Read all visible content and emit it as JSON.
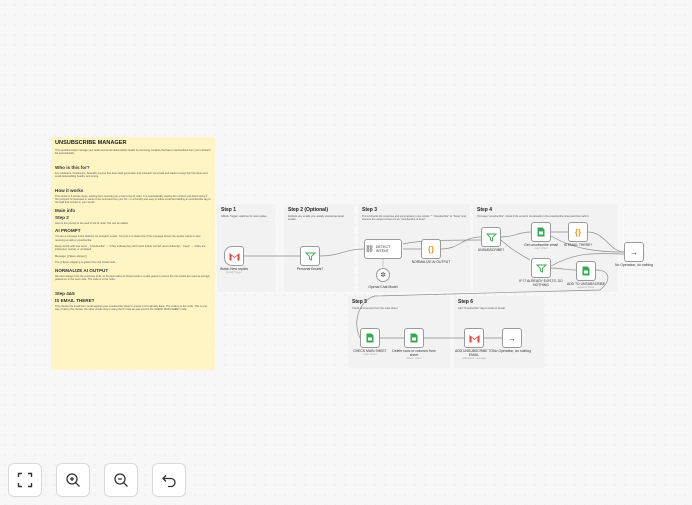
{
  "sticky": {
    "title": "UNSUBSCRIBE MANAGER",
    "intro": "This workflow helps manage your leads and email deliverability health by removing contacts that have unsubscribed from your outreach list automatically.",
    "who_title": "Who is this for?",
    "who_text": "For marketers, freelancers, basically anyone that does lead generation and outreach via emails and wants to keep their list clean and email deliverability healthy and strong.",
    "how_title": "How it works",
    "how_text": "This works in 6 simple steps, starting from receiving an email to the AI node. It is automatically reading the content and determining if the prospect is interested or wants to be removed from your list - in a friendly and easy to follow email and adding an unsubscribe tag to the lead that contact in your Gmail.",
    "main_info": "Main info",
    "step2_title": "Step 2",
    "step2_text": "Here is the prompt to be used in the AI node; this can be edited:",
    "ai_prompt_title": "AI PROMPT",
    "ai_prompt_text": "You are a message intent detector for outreach emails. Your job is to determine if the message shows the sender wants to stop receiving emails or unsubscribe.",
    "reply_text": "Reply strictly with one word: - \"unsubscribe\" → if they indicate they don't want further contact (even indirectly) - \"keep\" → if they are interested, neutral, or unrelated.",
    "message_text": "Message: {{ $json.snippet }}",
    "json_note": "The {{ $json.snippet }} is gotten from the Gmail node.",
    "normalize_title": "NORMALIZE AI OUTPUT",
    "normalize_text": "We can't always trust the response of AI, so the Normalize AI Output node is a safe guard to ensure the bot results are read as strongly passed on to the next node. The code is in the node.",
    "step4_title": "Step 4&5",
    "gmail_title": "IS EMAIL THERE?",
    "gmail_text": "This checks the email from Gmail against your unsubscribe sheet to ensure it isn't already there. The code is in the node. This is one way of doing the checks; the other simple way is using the IF node as was used in the CHECK MAIN SHEET node."
  },
  "steps": [
    {
      "title": "Step 1",
      "desc": "GMAIL Trigger: watches for new replies."
    },
    {
      "title": "Step 2 (Optional)",
      "desc": "Exclude any emails you usually receive/personal emails."
    },
    {
      "title": "Step 3",
      "desc": "The AI checks the response and summarises in two words: \"\" \"Unsubscribe\" or \"Keep\" and ensures the output comes out as \"unsubscribe or keep\"."
    },
    {
      "title": "Step 4",
      "desc": "If AI says \"unsubscribe\", check if the email is not already in the unsubscribe sheet and then add it."
    },
    {
      "title": "Step 5",
      "desc": "Check and remove from the main sheet"
    },
    {
      "title": "Step 6",
      "desc": "Add \"Unsubscribe\" tag to email on Gmail"
    }
  ],
  "nodes": {
    "watch": {
      "label": "Watch New replies",
      "sub": "Gmail Trigger"
    },
    "personal": {
      "label": "Personal Emails?"
    },
    "detect": {
      "label": "DETECT INTENT"
    },
    "normalize": {
      "label": "NORMALIZE AI OUTPUT"
    },
    "openai": {
      "label": "Openai Chat Model",
      "sub": "Model"
    },
    "unsub_filter": {
      "label": "UNSUBSCRIBE?"
    },
    "get_sheet": {
      "label": "Get unsubscribe email",
      "sub": "read: sheet"
    },
    "is_email": {
      "label": "IS EMAIL THERE?"
    },
    "noop1": {
      "label": "No Operation, do nothing"
    },
    "if_exists": {
      "label": "IF IT ALREADY EXISTS, DO NOTHING"
    },
    "add_unsub": {
      "label": "ADD TO UNSUBSCRIBE",
      "sub": "append: sheet"
    },
    "check_main": {
      "label": "CHECK MAIN SHEET",
      "sub": "read: sheet"
    },
    "delete_rows": {
      "label": "Delete rows or columns from sheet",
      "sub": "delete: sheet"
    },
    "add_tag": {
      "label": "ADD UNSUBSCRIBE TO EMAIL",
      "sub": "addLabels: message"
    },
    "noop2": {
      "label": "No Operation, do nothing"
    }
  },
  "toolbar": {
    "fit": "fit-view-icon",
    "zoom_in": "zoom-in-icon",
    "zoom_out": "zoom-out-icon",
    "undo": "undo-icon"
  },
  "colors": {
    "sticky": "#fff5c4",
    "step_bg": "#f2f2f2",
    "gmail_red": "#ea4335",
    "sheets_green": "#34a853",
    "code_orange": "#f39c12",
    "wire": "#8d8d8d"
  }
}
